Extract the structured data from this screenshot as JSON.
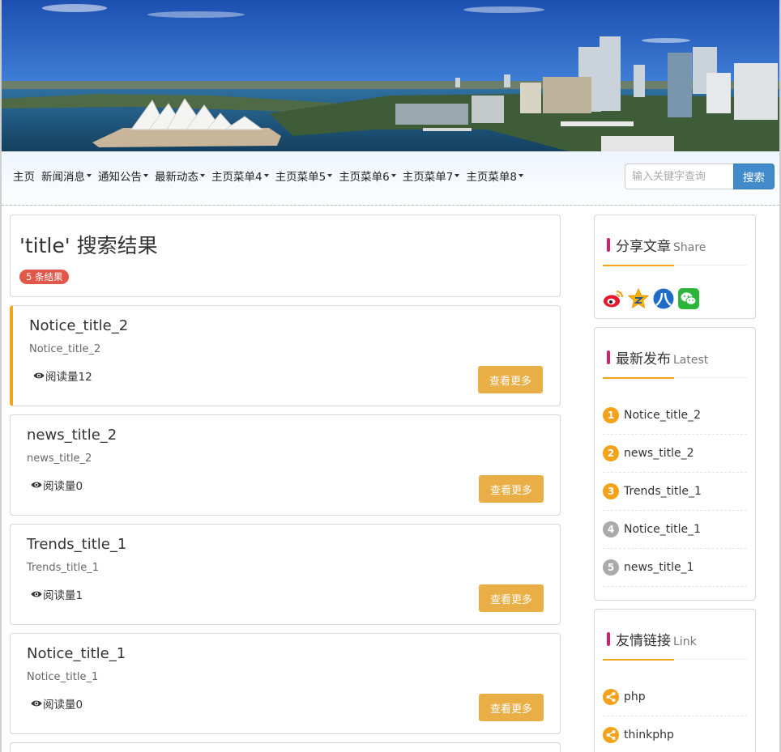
{
  "nav": {
    "items": [
      {
        "label": "主页",
        "dropdown": false
      },
      {
        "label": "新闻消息",
        "dropdown": true
      },
      {
        "label": "通知公告",
        "dropdown": true
      },
      {
        "label": "最新动态",
        "dropdown": true
      },
      {
        "label": "主页菜单4",
        "dropdown": true
      },
      {
        "label": "主页菜单5",
        "dropdown": true
      },
      {
        "label": "主页菜单6",
        "dropdown": true
      },
      {
        "label": "主页菜单7",
        "dropdown": true
      },
      {
        "label": "主页菜单8",
        "dropdown": true
      }
    ],
    "search_placeholder": "输入关键字查询",
    "search_button": "搜索"
  },
  "results": {
    "heading": "'title' 搜索结果",
    "count_badge": "5 条结果"
  },
  "articles": [
    {
      "title": "Notice_title_2",
      "desc": "Notice_title_2",
      "views": "阅读量12",
      "more": "查看更多"
    },
    {
      "title": "news_title_2",
      "desc": "news_title_2",
      "views": "阅读量0",
      "more": "查看更多"
    },
    {
      "title": "Trends_title_1",
      "desc": "Trends_title_1",
      "views": "阅读量1",
      "more": "查看更多"
    },
    {
      "title": "Notice_title_1",
      "desc": "Notice_title_1",
      "views": "阅读量0",
      "more": "查看更多"
    }
  ],
  "sidebar": {
    "share": {
      "title": "分享文章",
      "sub": "Share",
      "icons": [
        "weibo-icon",
        "qzone-icon",
        "renren-icon",
        "wechat-icon"
      ]
    },
    "latest": {
      "title": "最新发布",
      "sub": "Latest",
      "items": [
        {
          "num": "1",
          "label": "Notice_title_2"
        },
        {
          "num": "2",
          "label": "news_title_2"
        },
        {
          "num": "3",
          "label": "Trends_title_1"
        },
        {
          "num": "4",
          "label": "Notice_title_1"
        },
        {
          "num": "5",
          "label": "news_title_1"
        }
      ]
    },
    "links": {
      "title": "友情链接",
      "sub": "Link",
      "items": [
        {
          "label": "php"
        },
        {
          "label": "thinkphp"
        }
      ]
    }
  },
  "colors": {
    "accent_orange": "#f5a21b",
    "button_gold": "#e9ae45",
    "search_blue": "#428bca",
    "badge_red": "#e3574a",
    "title_mark": "#d1206e",
    "rank_gray": "#aaaaaa"
  }
}
